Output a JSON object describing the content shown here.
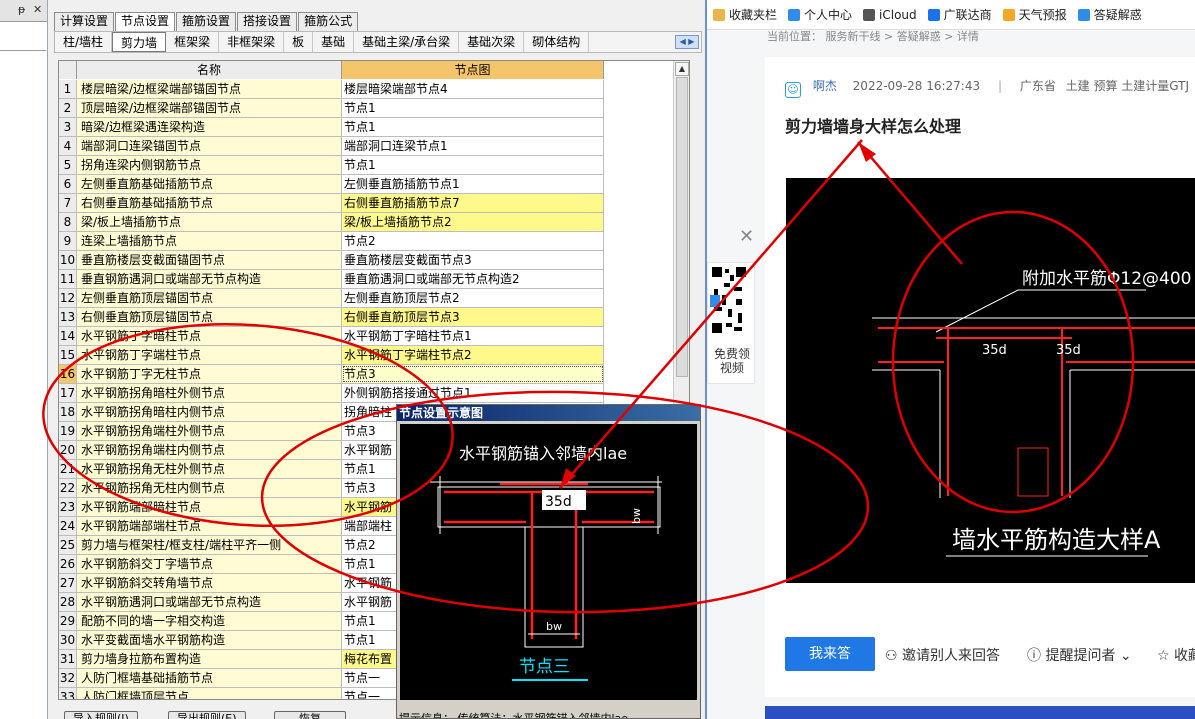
{
  "left_panel": {
    "pin": "ᵽ",
    "close": "✕"
  },
  "main_tabs": [
    "计算设置",
    "节点设置",
    "箍筋设置",
    "搭接设置",
    "箍筋公式"
  ],
  "main_tab_active": 1,
  "sub_tabs": [
    "柱/墙柱",
    "剪力墙",
    "框架梁",
    "非框架梁",
    "板",
    "基础",
    "基础主梁/承台梁",
    "基础次梁",
    "砌体结构"
  ],
  "sub_tab_active": 1,
  "grid": {
    "col_name": "名称",
    "col_node": "节点图",
    "rows": [
      {
        "n": "1",
        "name": "楼层暗梁/边框梁端部锚固节点",
        "node": "楼层暗梁端部节点4",
        "hl": false
      },
      {
        "n": "2",
        "name": "顶层暗梁/边框梁端部锚固节点",
        "node": "节点1",
        "hl": false
      },
      {
        "n": "3",
        "name": "暗梁/边框梁遇连梁构造",
        "node": "节点1",
        "hl": false
      },
      {
        "n": "4",
        "name": "端部洞口连梁锚固节点",
        "node": "端部洞口连梁节点1",
        "hl": false
      },
      {
        "n": "5",
        "name": "拐角连梁内侧钢筋节点",
        "node": "节点1",
        "hl": false
      },
      {
        "n": "6",
        "name": "左侧垂直筋基础插筋节点",
        "node": "左侧垂直筋插筋节点1",
        "hl": false
      },
      {
        "n": "7",
        "name": "右侧垂直筋基础插筋节点",
        "node": "右侧垂直筋插筋节点7",
        "hl": true
      },
      {
        "n": "8",
        "name": "梁/板上墙插筋节点",
        "node": "梁/板上墙插筋节点2",
        "hl": true
      },
      {
        "n": "9",
        "name": "连梁上墙插筋节点",
        "node": "节点2",
        "hl": false
      },
      {
        "n": "10",
        "name": "垂直筋楼层变截面锚固节点",
        "node": "垂直筋楼层变截面节点3",
        "hl": false
      },
      {
        "n": "11",
        "name": "垂直钢筋遇洞口或端部无节点构造",
        "node": "垂直筋遇洞口或端部无节点构造2",
        "hl": false
      },
      {
        "n": "12",
        "name": "左侧垂直筋顶层锚固节点",
        "node": "左侧垂直筋顶层节点2",
        "hl": false
      },
      {
        "n": "13",
        "name": "右侧垂直筋顶层锚固节点",
        "node": "右侧垂直筋顶层节点3",
        "hl": true
      },
      {
        "n": "14",
        "name": "水平钢筋丁字暗柱节点",
        "node": "水平钢筋丁字暗柱节点1",
        "hl": false
      },
      {
        "n": "15",
        "name": "水平钢筋丁字端柱节点",
        "node": "水平钢筋丁字端柱节点2",
        "hl": true
      },
      {
        "n": "16",
        "name": "水平钢筋丁字无柱节点",
        "node": "节点3",
        "hl": false,
        "sel": true
      },
      {
        "n": "17",
        "name": "水平钢筋拐角暗柱外侧节点",
        "node": "外侧钢筋搭接通过节点1",
        "hl": false
      },
      {
        "n": "18",
        "name": "水平钢筋拐角暗柱内侧节点",
        "node": "拐角暗柱",
        "hl": false
      },
      {
        "n": "19",
        "name": "水平钢筋拐角端柱外侧节点",
        "node": "节点3",
        "hl": false
      },
      {
        "n": "20",
        "name": "水平钢筋拐角端柱内侧节点",
        "node": "水平钢筋",
        "hl": false
      },
      {
        "n": "21",
        "name": "水平钢筋拐角无柱外侧节点",
        "node": "节点1",
        "hl": false
      },
      {
        "n": "22",
        "name": "水平钢筋拐角无柱内侧节点",
        "node": "节点3",
        "hl": false
      },
      {
        "n": "23",
        "name": "水平钢筋端部暗柱节点",
        "node": "水平钢筋",
        "hl": true
      },
      {
        "n": "24",
        "name": "水平钢筋端部端柱节点",
        "node": "端部端柱",
        "hl": false
      },
      {
        "n": "25",
        "name": "剪力墙与框架柱/框支柱/端柱平齐一侧",
        "node": "节点2",
        "hl": false
      },
      {
        "n": "26",
        "name": "水平钢筋斜交丁字墙节点",
        "node": "节点1",
        "hl": false
      },
      {
        "n": "27",
        "name": "水平钢筋斜交转角墙节点",
        "node": "水平钢筋",
        "hl": false
      },
      {
        "n": "28",
        "name": "水平钢筋遇洞口或端部无节点构造",
        "node": "水平钢筋",
        "hl": false
      },
      {
        "n": "29",
        "name": "配筋不同的墙一字相交构造",
        "node": "节点1",
        "hl": false
      },
      {
        "n": "30",
        "name": "水平变截面墙水平钢筋构造",
        "node": "节点1",
        "hl": false
      },
      {
        "n": "31",
        "name": "剪力墙身拉筋布置构造",
        "node": "梅花布置",
        "hl": true
      },
      {
        "n": "32",
        "name": "人防门框墙基础插筋节点",
        "node": "节点一",
        "hl": false
      },
      {
        "n": "33",
        "name": "人防门框墙顶层节点",
        "node": "节点一",
        "hl": false
      }
    ]
  },
  "bottom_buttons": [
    "导入规则(I)",
    "导出规则(E)",
    "恢复"
  ],
  "popup": {
    "title": "节点设置示意图",
    "caption": "水平钢筋锚入邻墙内lae",
    "dim1": "35d",
    "dim_bw_side": "bw",
    "dim_bw_bottom": "bw",
    "node_label": "节点三",
    "hint": "提示信息：  传统算法：水平钢筋锚入邻墙内lae"
  },
  "browser": {
    "bookmarks": [
      {
        "label": "收藏夹栏",
        "color": "#e8b54a"
      },
      {
        "label": "个人中心",
        "color": "#2f8ce8"
      },
      {
        "label": "iCloud",
        "color": "#555555"
      },
      {
        "label": "广联达商",
        "color": "#1a73e8"
      },
      {
        "label": "天气预报",
        "color": "#f5a623"
      },
      {
        "label": "答疑解惑",
        "color": "#2f8ce8"
      }
    ],
    "crumb": "当前位置：  服务新干线 > 答疑解惑 > 详情",
    "author": "啊杰",
    "date": "2022-09-28 16:27:43",
    "sep": "|",
    "location": "广东省",
    "tags": "土建 预算 土建计量GTJ",
    "title": "剪力墙墙身大样怎么处理",
    "cad_note": "附加水平筋Φ12@400",
    "cad_dim1": "35d",
    "cad_dim2": "35d",
    "cad_title": "墙水平筋构造大样A",
    "qr_text": "免费领视频",
    "answer_btn": "我来答",
    "invite": "邀请别人来回答",
    "remind": "提醒提问者",
    "fav": "收藏"
  },
  "colors": {
    "annotation": "#e00000",
    "grid_header": "#f4c56a",
    "row_hl": "#fff88a",
    "primary": "#1f78e6"
  }
}
